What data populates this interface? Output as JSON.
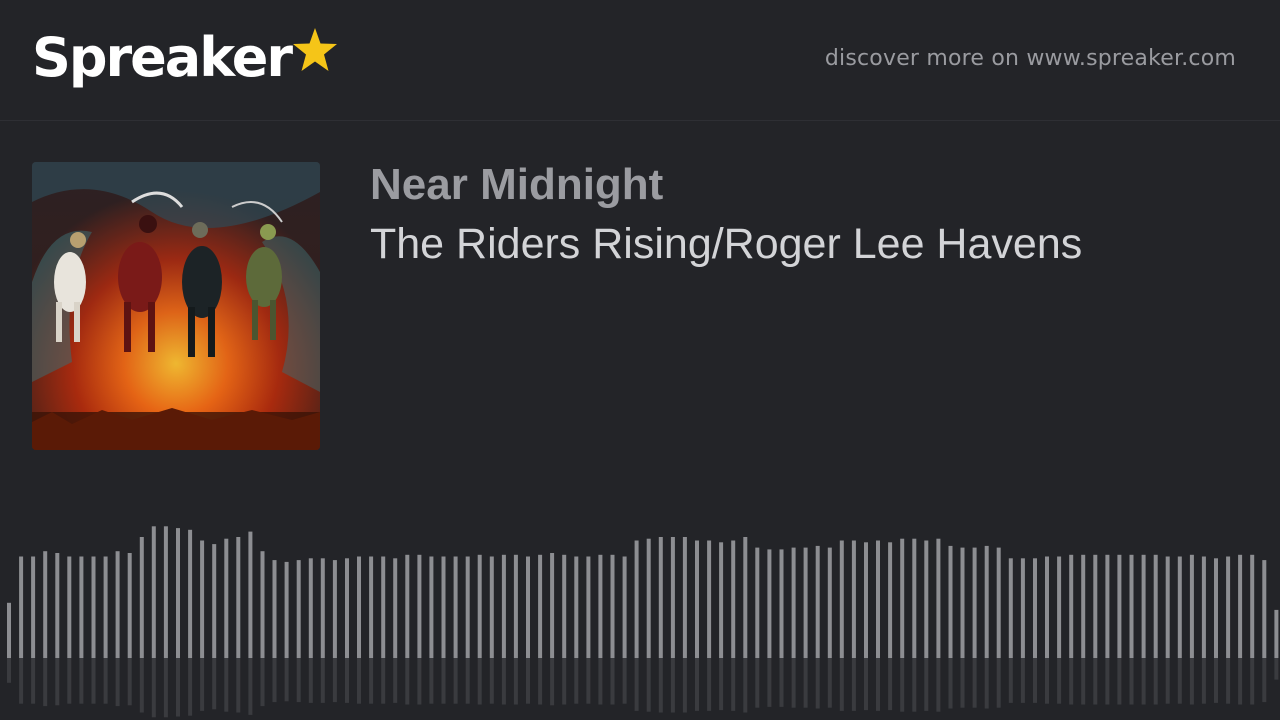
{
  "brand": {
    "name": "Spreaker",
    "star_color": "#f5c518",
    "discover_text": "discover more on www.spreaker.com"
  },
  "episode": {
    "show_title": "Near Midnight",
    "episode_title": "The Riders Rising/Roger Lee Havens",
    "cover_art": "four-horsemen-cover-art"
  },
  "waveform": {
    "color": "#8d8e92",
    "levels": [
      0.31,
      0.57,
      0.57,
      0.6,
      0.59,
      0.57,
      0.57,
      0.57,
      0.57,
      0.6,
      0.59,
      0.68,
      0.74,
      0.74,
      0.73,
      0.72,
      0.66,
      0.64,
      0.67,
      0.68,
      0.71,
      0.6,
      0.55,
      0.54,
      0.55,
      0.56,
      0.56,
      0.55,
      0.56,
      0.57,
      0.57,
      0.57,
      0.56,
      0.58,
      0.58,
      0.57,
      0.57,
      0.57,
      0.57,
      0.58,
      0.57,
      0.58,
      0.58,
      0.57,
      0.58,
      0.59,
      0.58,
      0.57,
      0.57,
      0.58,
      0.58,
      0.57,
      0.66,
      0.67,
      0.68,
      0.68,
      0.68,
      0.66,
      0.66,
      0.65,
      0.66,
      0.68,
      0.62,
      0.61,
      0.61,
      0.62,
      0.62,
      0.63,
      0.62,
      0.66,
      0.66,
      0.65,
      0.66,
      0.65,
      0.67,
      0.67,
      0.66,
      0.67,
      0.63,
      0.62,
      0.62,
      0.63,
      0.62,
      0.56,
      0.56,
      0.56,
      0.57,
      0.57,
      0.58,
      0.58,
      0.58,
      0.58,
      0.58,
      0.58,
      0.58,
      0.58,
      0.57,
      0.57,
      0.58,
      0.57,
      0.56,
      0.57,
      0.58,
      0.58,
      0.55,
      0.27,
      0.27,
      0.17,
      0.12,
      0.02
    ]
  }
}
